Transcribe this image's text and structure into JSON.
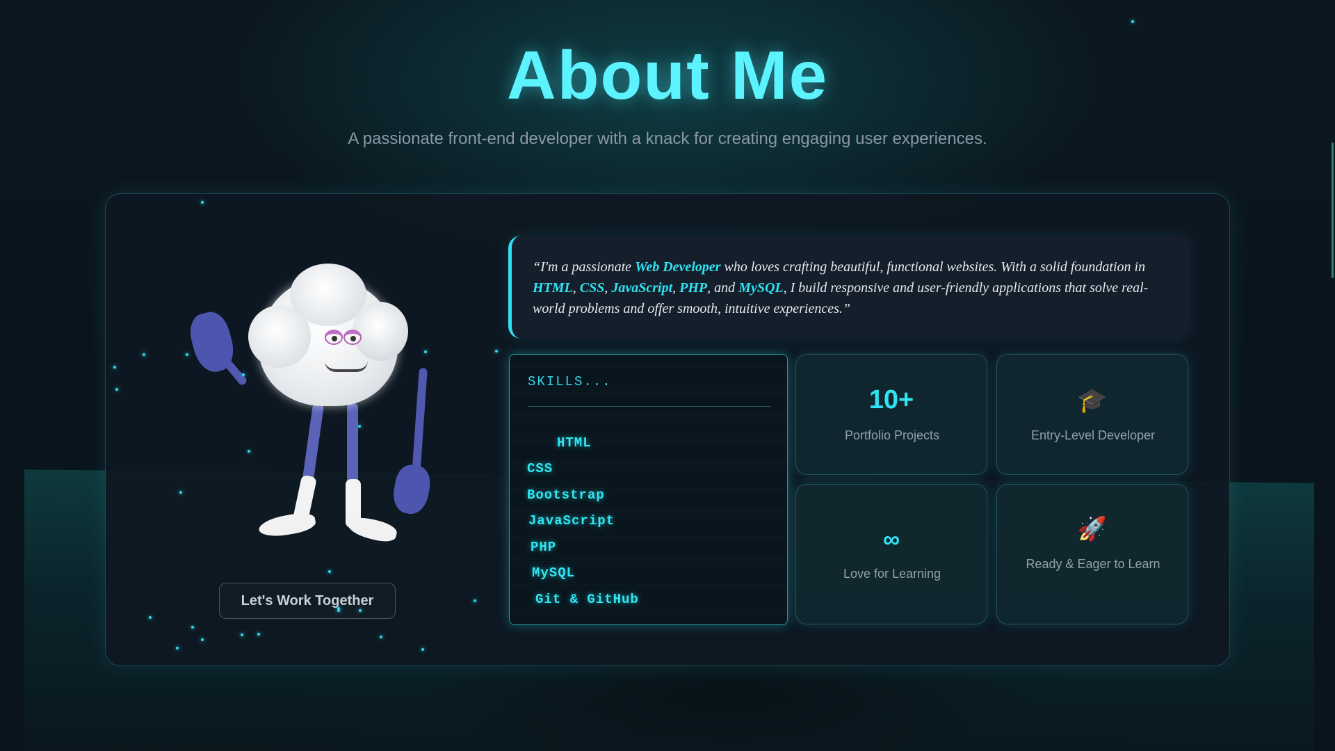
{
  "header": {
    "title": "About Me",
    "subtitle": "A passionate front-end developer with a knack for creating engaging user experiences."
  },
  "profile": {
    "cta_label": "Let's Work Together"
  },
  "quote": {
    "p1": "“I'm a passionate ",
    "role": "Web Developer",
    "p2": " who loves crafting beautiful, functional websites. With a solid foundation in ",
    "html": "HTML",
    "sep1": ", ",
    "css": "CSS",
    "sep2": ", ",
    "js": "JavaScript",
    "sep3": ", ",
    "php": "PHP",
    "sep4": ", and ",
    "mysql": "MySQL",
    "p3": ", I build responsive and user-friendly applications that solve real-world problems and offer smooth, intuitive experiences.”"
  },
  "skills": {
    "title": "SKILLS...",
    "items": [
      "HTML",
      "CSS",
      "Bootstrap",
      "JavaScript",
      "PHP",
      "MySQL",
      "Git & GitHub"
    ]
  },
  "stats": [
    {
      "value": "10+",
      "label": "Portfolio Projects"
    },
    {
      "icon": "graduation-cap-icon",
      "glyph": "🎓",
      "label": "Entry-Level Developer"
    },
    {
      "value": "∞",
      "label": "Love for Learning"
    },
    {
      "icon": "rocket-icon",
      "glyph": "🚀",
      "label": "Ready & Eager to Learn"
    }
  ],
  "colors": {
    "accent": "#2fe3f2",
    "title": "#5cf3ff",
    "background": "#0a141c"
  }
}
